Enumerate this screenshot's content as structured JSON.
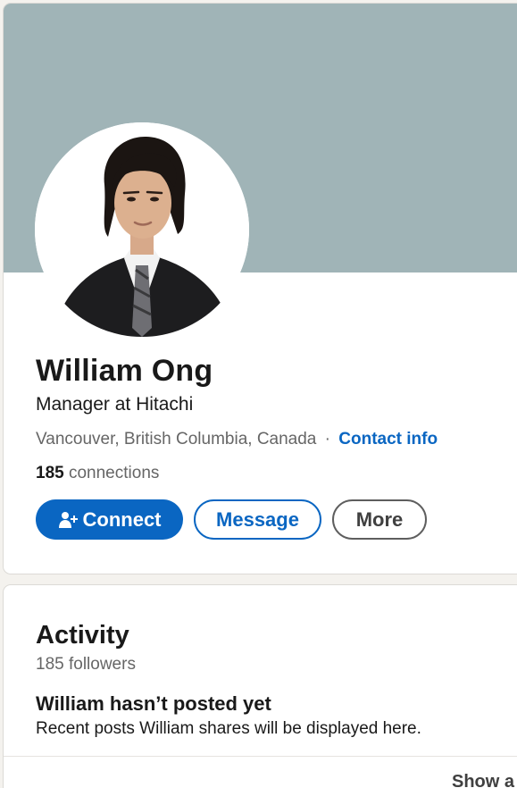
{
  "profile": {
    "name": "William Ong",
    "headline": "Manager at Hitachi",
    "location": "Vancouver, British Columbia, Canada",
    "separator": "·",
    "contact_info": "Contact info",
    "connections_count": "185",
    "connections_label": "connections",
    "banner_color": "#a0b4b7"
  },
  "actions": {
    "connect": "Connect",
    "message": "Message",
    "more": "More",
    "connect_icon": "add-person-icon",
    "accent_color": "#0a66c2"
  },
  "activity": {
    "title": "Activity",
    "followers": "185 followers",
    "empty_title": "William hasn’t posted yet",
    "empty_desc": "Recent posts William shares will be displayed here.",
    "show_all": "Show a"
  }
}
